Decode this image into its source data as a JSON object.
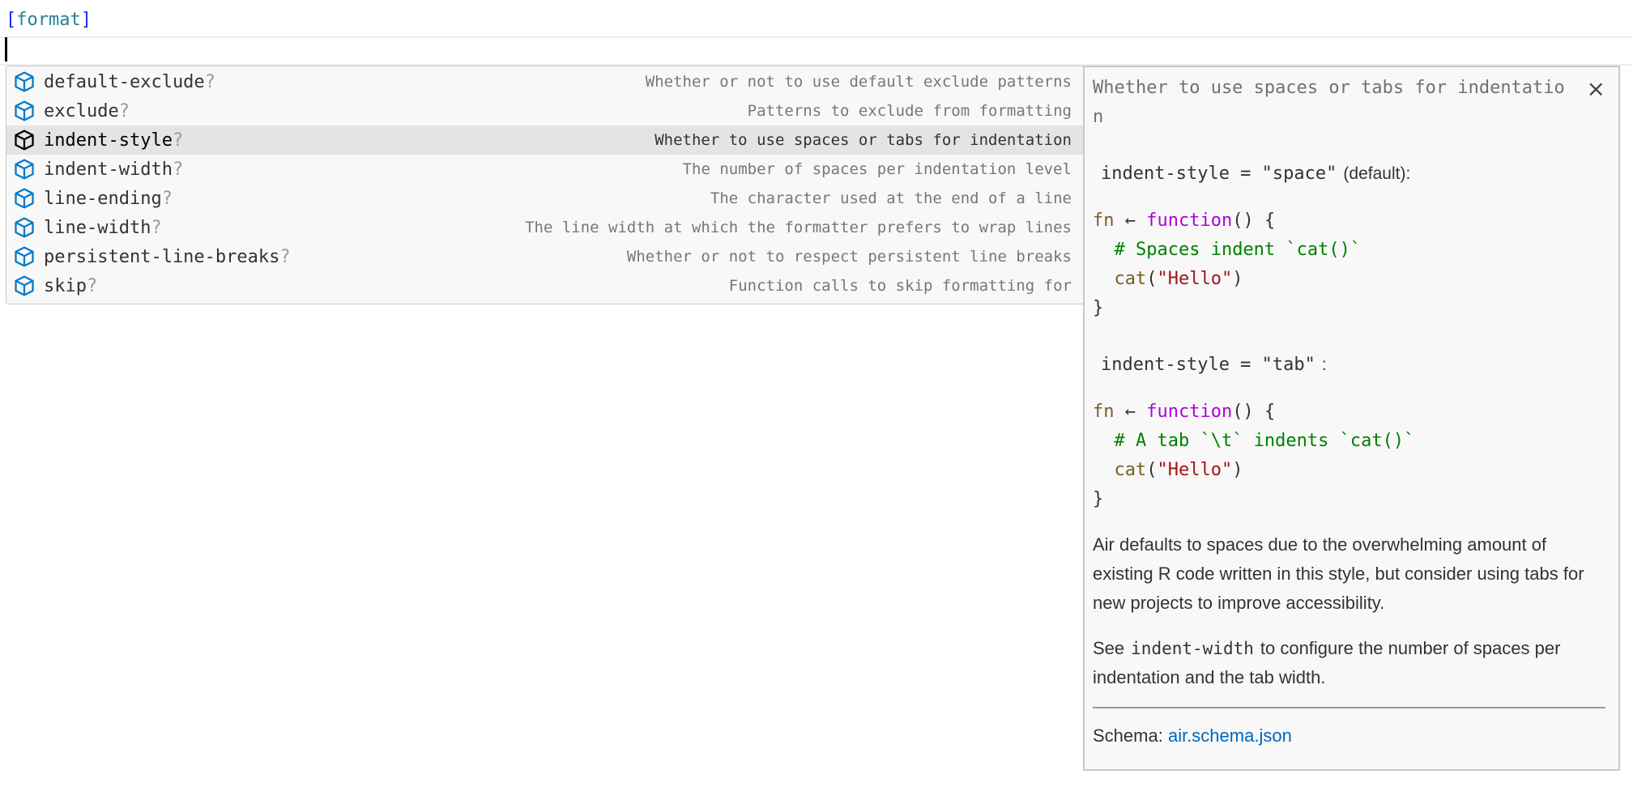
{
  "editor": {
    "section_open": "[",
    "section_name": "format",
    "section_close": "]"
  },
  "suggestions": [
    {
      "label": "default-exclude",
      "suffix": "?",
      "description": "Whether or not to use default exclude patterns",
      "selected": false
    },
    {
      "label": "exclude",
      "suffix": "?",
      "description": "Patterns to exclude from formatting",
      "selected": false
    },
    {
      "label": "indent-style",
      "suffix": "?",
      "description": "Whether to use spaces or tabs for indentation",
      "selected": true
    },
    {
      "label": "indent-width",
      "suffix": "?",
      "description": "The number of spaces per indentation level",
      "selected": false
    },
    {
      "label": "line-ending",
      "suffix": "?",
      "description": "The character used at the end of a line",
      "selected": false
    },
    {
      "label": "line-width",
      "suffix": "?",
      "description": "The line width at which the formatter prefers to wrap lines",
      "selected": false
    },
    {
      "label": "persistent-line-breaks",
      "suffix": "?",
      "description": "Whether or not to respect persistent line breaks",
      "selected": false
    },
    {
      "label": "skip",
      "suffix": "?",
      "description": "Function calls to skip formatting for",
      "selected": false
    }
  ],
  "doc": {
    "title": "Whether to use spaces or tabs for indentation",
    "close_label": "×",
    "space_heading": "indent-style = \"space\"",
    "space_note": "(default):",
    "space_code": {
      "fn": "fn",
      "arrow": "←",
      "kw": "function",
      "paren": "() {",
      "comment": "# Spaces indent `cat()`",
      "call": "cat",
      "open": "(",
      "str": "\"Hello\"",
      "close": ")",
      "end": "}"
    },
    "tab_heading": "indent-style = \"tab\"",
    "tab_note": ":",
    "tab_code": {
      "fn": "fn",
      "arrow": "←",
      "kw": "function",
      "paren": "() {",
      "comment": "# A tab `\\t` indents `cat()`",
      "call": "cat",
      "open": "(",
      "str": "\"Hello\"",
      "close": ")",
      "end": "}"
    },
    "para1": "Air defaults to spaces due to the overwhelming amount of existing R code written in this style, but consider using tabs for new projects to improve accessibility.",
    "para2_pre": "See",
    "para2_code": "indent-width",
    "para2_post": "to configure the number of spaces per indentation and the tab width.",
    "schema_label": "Schema:",
    "schema_link": "air.schema.json"
  },
  "colors": {
    "icon": "#007acc",
    "selected_bg": "#e4e4e4",
    "link": "#0066bf"
  }
}
